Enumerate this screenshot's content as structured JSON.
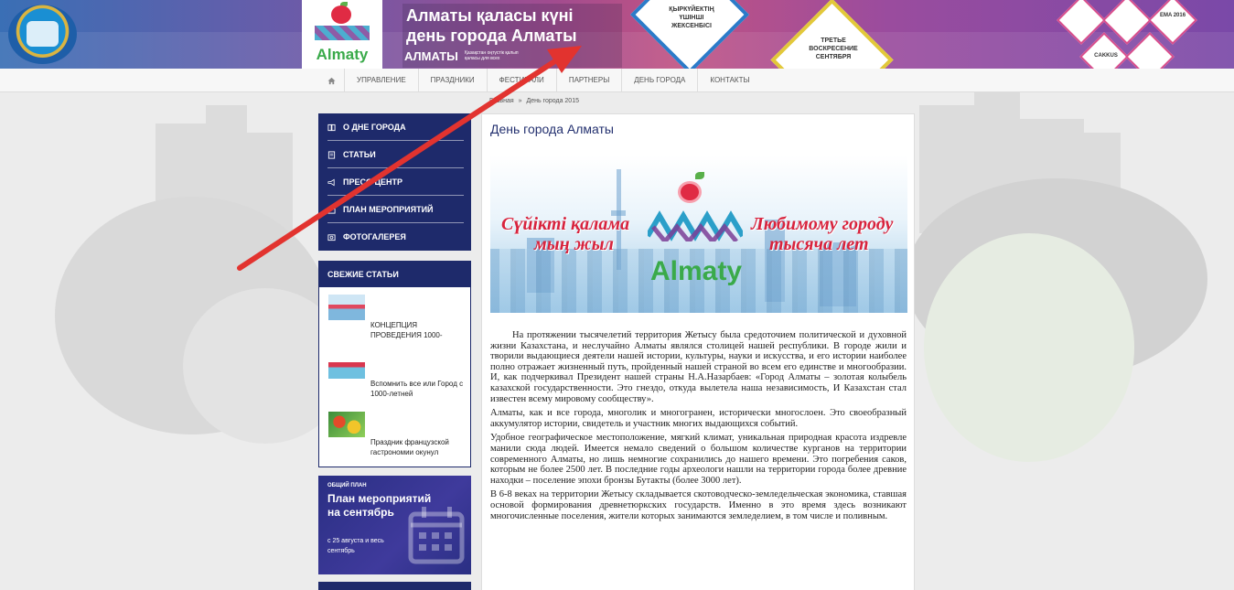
{
  "banner": {
    "title_line1": "Алматы қаласы күні",
    "title_line2": "день города Алматы",
    "city_word": "АЛМАТЫ",
    "city_subtitle": "Қазақстан оңтүстік қалып қаласы для всех",
    "logo_word": "Almaty",
    "diamond1_text": "ҚЫРКҮЙЕКТІҢ ҮШІНШІ ЖЕКСЕНБІСІ",
    "diamond2_text": "ТРЕТЬЕ ВОСКРЕСЕНИЕ СЕНТЯБРЯ",
    "partner_label_1": "EMA 2016",
    "partner_label_2": "CAKKUS"
  },
  "nav": {
    "items": [
      {
        "label": "УПРАВЛЕНИЕ"
      },
      {
        "label": "ПРАЗДНИКИ"
      },
      {
        "label": "ФЕСТИВАЛИ"
      },
      {
        "label": "ПАРТНЕРЫ"
      },
      {
        "label": "ДЕНЬ ГОРОДА"
      },
      {
        "label": "КОНТАКТЫ"
      }
    ]
  },
  "breadcrumb": {
    "home": "Главная",
    "separator": "»",
    "current": "День города 2015"
  },
  "sidebar": {
    "items": [
      {
        "label": "О ДНЕ ГОРОДА",
        "icon": "book-icon"
      },
      {
        "label": "СТАТЬИ",
        "icon": "document-icon"
      },
      {
        "label": "ПРЕСС-ЦЕНТР",
        "icon": "megaphone-icon"
      },
      {
        "label": "ПЛАН МЕРОПРИЯТИЙ",
        "icon": "calendar-icon"
      },
      {
        "label": "ФОТОГАЛЕРЕЯ",
        "icon": "photo-icon"
      }
    ],
    "fresh_title": "СВЕЖИЕ СТАТЬИ",
    "articles": [
      {
        "title": "КОНЦЕПЦИЯ ПРОВЕДЕНИЯ 1000-"
      },
      {
        "title": "Вспомнить все или Город с 1000-летней"
      },
      {
        "title": "Праздник французской гастрономии окунул"
      }
    ],
    "plan": {
      "small": "ОБЩИЙ ПЛАН",
      "title": "План мероприятий на сентябрь",
      "note": "с 25 августа и весь сентябрь"
    }
  },
  "main": {
    "title": "День города Алматы",
    "hero": {
      "left_phrase_1": "Сүйікті қалама",
      "left_phrase_2": "мың жыл",
      "right_phrase_1": "Любимому городу",
      "right_phrase_2": "тысяча лет",
      "logo_word": "Almaty"
    },
    "paragraphs": [
      "На протяжении тысячелетий территория Жетысу была средоточием политической и духовной жизни Казахстана, и неслучайно Алматы являлся столицей нашей республики. В городе жили и творили выдающиеся деятели нашей истории, культуры, науки и искусства, и его истории наиболее полно отражает жизненный путь, пройденный нашей страной во всем его единстве и многообразии. И, как подчеркивал Президент нашей страны Н.А.Назарбаев: «Город Алматы – золотая колыбель казахской государственности. Это гнездо, откуда вылетела наша независимость, И Казахстан стал известен всему мировому сообществу».",
      "Алматы, как и все города, многолик и многогранен, исторически многослоен. Это своеобразный аккумулятор истории, свидетель и участник многих выдающихся событий.",
      "Удобное географическое местоположение, мягкий климат, уникальная природная красота издревле манили сюда людей. Имеется немало сведений о большом количестве курганов на территории современного Алматы, но лишь немногие сохранились до нашего времени. Это погребения саков, которым не более 2500 лет. В последние годы археологи нашли на территории города более древние находки – поселение эпохи бронзы Бутакты (более 3000 лет).",
      "В 6-8 веках на территории Жетысу складывается скотоводческо-земледельческая экономика, ставшая основой формирования древнетюркских государств. Именно в это время здесь возникают многочисленные поселения, жители которых занимаются земледелием, в том числе и поливным."
    ]
  },
  "colors": {
    "navy": "#1e2a6b",
    "annotation_arrow": "#e2332f",
    "title_blue": "#23306f",
    "hero_red": "#d8233d",
    "brand_green": "#3aaa4a"
  }
}
